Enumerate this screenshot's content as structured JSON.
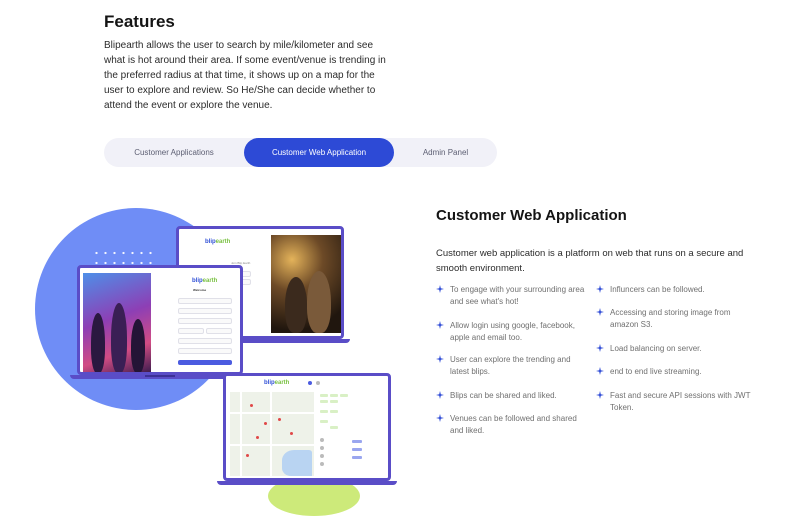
{
  "features": {
    "title": "Features",
    "description": "Blipearth allows the user to search by mile/kilometer and see what is hot around their area. If some event/venue is trending in the preferred radius at that time, it shows up on a map for the user to explore and review. So He/She can decide whether to attend the event or explore the venue."
  },
  "tabs": [
    {
      "label": "Customer Applications",
      "active": false
    },
    {
      "label": "Customer Web Application",
      "active": true
    },
    {
      "label": "Admin Panel",
      "active": false
    }
  ],
  "mockup": {
    "logo_prefix": "blip",
    "logo_suffix": "earth",
    "login_heading": "Welcome",
    "sign_in_label": "Sign In",
    "join_label": "Join Blip Earth"
  },
  "section": {
    "title": "Customer Web Application",
    "description": "Customer web application is a platform on web that runs on a secure and smooth environment."
  },
  "features_left": [
    "To engage with your surrounding area and see what's hot!",
    "Allow login using google, facebook, apple and email too.",
    "User can explore the trending and latest blips.",
    "Blips can be shared and liked.",
    "Venues can be followed and shared and liked."
  ],
  "features_right": [
    "Influncers can be followed.",
    "Accessing and storing image from amazon S3.",
    "Load balancing on server.",
    "end to end live streaming.",
    "Fast and secure API sessions with JWT Token."
  ],
  "colors": {
    "accent": "#2d4ad6",
    "star": "#2d4ad6",
    "laptop_frame": "#5a4dc7",
    "circle": "#6f8df6",
    "green": "#cdea7a"
  }
}
